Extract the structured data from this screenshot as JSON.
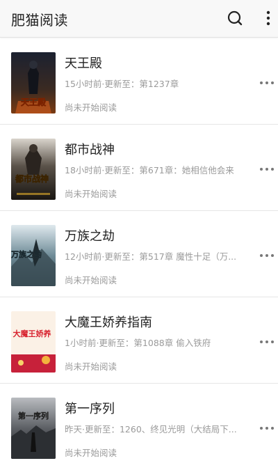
{
  "header": {
    "title": "肥猫阅读",
    "search_icon": "search-icon",
    "menu_icon": "more-vertical-icon"
  },
  "books": [
    {
      "title": "天王殿",
      "update": "15小时前·更新至：第1237章",
      "status": "尚未开始阅读",
      "cover_text": "天王殿"
    },
    {
      "title": "都市战神",
      "update": "18小时前·更新至：第671章：她相信他会来",
      "status": "尚未开始阅读",
      "cover_text": "都市战神"
    },
    {
      "title": "万族之劫",
      "update": "12小时前·更新至：第517章 魔性十足（万...",
      "status": "尚未开始阅读",
      "cover_text": "万族之劫"
    },
    {
      "title": "大魔王娇养指南",
      "update": "1小时前·更新至：第1088章 偷入铁府",
      "status": "尚未开始阅读",
      "cover_text": "大魔王娇养"
    },
    {
      "title": "第一序列",
      "update": "昨天·更新至：1260、终见光明（大结局下...",
      "status": "尚未开始阅读",
      "cover_text": "第一序列"
    }
  ],
  "colors": {
    "title": "#222222",
    "meta": "#9a9a9a",
    "header_bg": "#f8f8f8",
    "divider": "#e6e6e6"
  }
}
